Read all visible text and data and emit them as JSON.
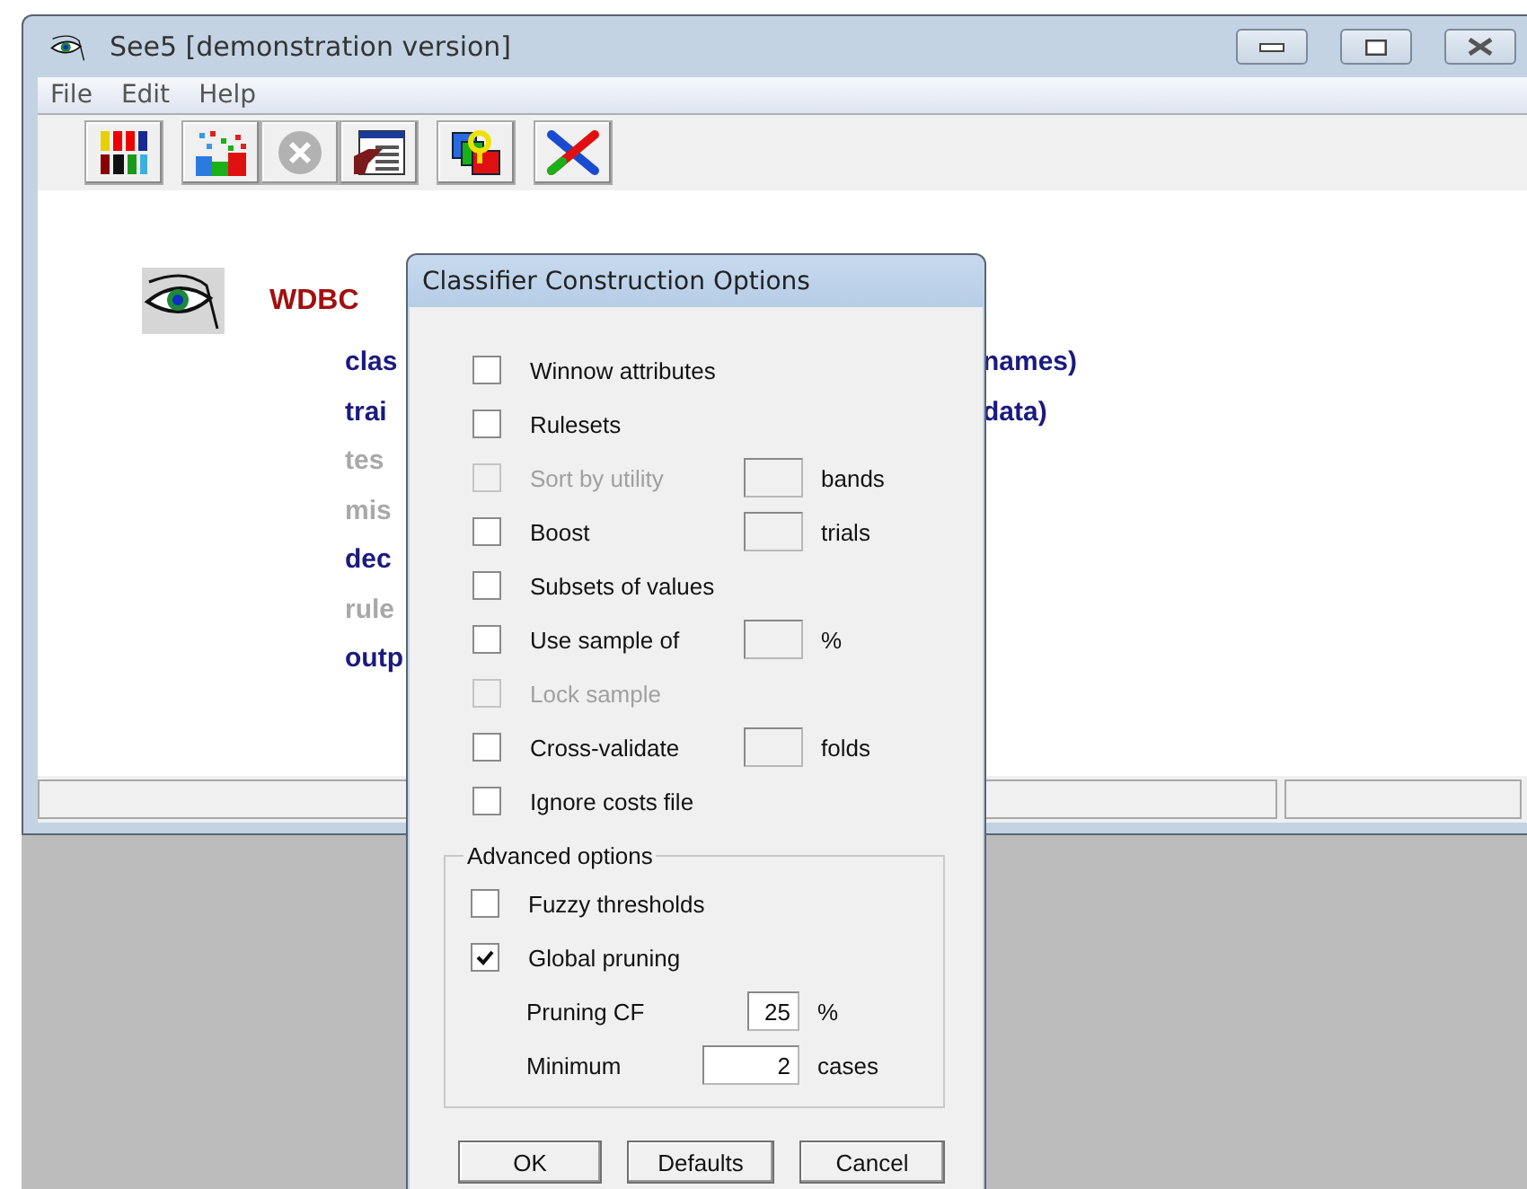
{
  "window": {
    "title": "See5 [demonstration version]"
  },
  "menu": [
    {
      "label": "File"
    },
    {
      "label": "Edit"
    },
    {
      "label": "Help"
    }
  ],
  "toolbar": [
    {
      "kind": "digits",
      "disabled": false
    },
    {
      "kind": "scatter",
      "disabled": false
    },
    {
      "kind": "cancel",
      "disabled": true
    },
    {
      "kind": "report",
      "disabled": false
    },
    {
      "kind": "query",
      "disabled": false
    },
    {
      "kind": "cross",
      "disabled": false
    }
  ],
  "project": {
    "name": "WDBC",
    "rows": [
      {
        "left": "clas",
        "right": "names)",
        "disabled": false
      },
      {
        "left": "trai",
        "right": "data)",
        "disabled": false
      },
      {
        "left": "tes",
        "disabled": true
      },
      {
        "left": "mis",
        "disabled": true
      },
      {
        "left": "dec",
        "disabled": false
      },
      {
        "left": "rule",
        "disabled": true
      },
      {
        "left": "outp",
        "disabled": false
      }
    ]
  },
  "dialog": {
    "title": "Classifier Construction Options",
    "options": [
      {
        "kind": "checkbox",
        "label": "Winnow attributes",
        "checked": false,
        "disabled": false
      },
      {
        "kind": "checkbox",
        "label": "Rulesets",
        "checked": false,
        "disabled": false
      },
      {
        "kind": "checkbox_field",
        "label": "Sort by utility",
        "checked": false,
        "disabled": true,
        "unit": "bands"
      },
      {
        "kind": "checkbox_field",
        "label": "Boost",
        "checked": false,
        "disabled": false,
        "unit": "trials"
      },
      {
        "kind": "checkbox",
        "label": "Subsets of values",
        "checked": false,
        "disabled": false
      },
      {
        "kind": "checkbox_field",
        "label": "Use sample of",
        "checked": false,
        "disabled": false,
        "unit": "%"
      },
      {
        "kind": "checkbox",
        "label": "Lock sample",
        "checked": false,
        "disabled": true
      },
      {
        "kind": "checkbox_field",
        "label": "Cross-validate",
        "checked": false,
        "disabled": false,
        "unit": "folds"
      },
      {
        "kind": "checkbox",
        "label": "Ignore costs file",
        "checked": false,
        "disabled": false
      }
    ],
    "advanced": {
      "title": "Advanced options",
      "options": [
        {
          "kind": "checkbox",
          "label": "Fuzzy thresholds",
          "checked": false,
          "disabled": false
        },
        {
          "kind": "checkbox",
          "label": "Global pruning",
          "checked": true,
          "disabled": false
        },
        {
          "kind": "field",
          "label": "Pruning CF",
          "value": "25",
          "unit": "%",
          "wide": false
        },
        {
          "kind": "field",
          "label": "Minimum",
          "value": "2",
          "unit": "cases",
          "wide": true
        }
      ]
    },
    "buttons": [
      {
        "label": "OK"
      },
      {
        "label": "Defaults"
      },
      {
        "label": "Cancel"
      }
    ]
  }
}
